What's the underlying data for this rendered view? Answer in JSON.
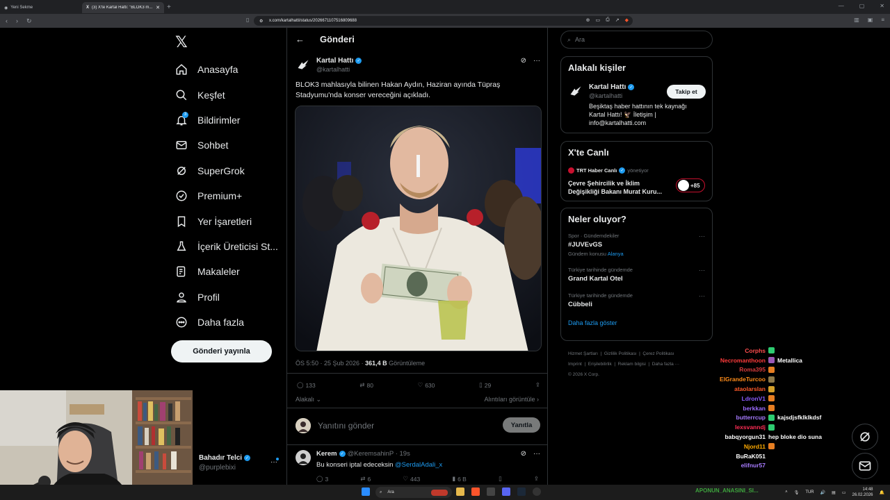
{
  "browser": {
    "tabs": [
      {
        "title": "Yeni Sekme",
        "active": false
      },
      {
        "title": "(3) X'te Kartal Hattı: \"BLOK3 m...",
        "active": true
      }
    ],
    "url": "x.com/kartalhatti/status/2026671107516809688"
  },
  "sidebar": {
    "items": [
      {
        "label": "Anasayfa",
        "icon": "home-icon"
      },
      {
        "label": "Keşfet",
        "icon": "search-icon"
      },
      {
        "label": "Bildirimler",
        "icon": "bell-icon",
        "badge": "3"
      },
      {
        "label": "Sohbet",
        "icon": "mail-icon"
      },
      {
        "label": "SuperGrok",
        "icon": "grok-icon"
      },
      {
        "label": "Premium+",
        "icon": "verified-icon"
      },
      {
        "label": "Yer İşaretleri",
        "icon": "bookmark-icon"
      },
      {
        "label": "İçerik Üreticisi St...",
        "icon": "flask-icon"
      },
      {
        "label": "Makaleler",
        "icon": "article-icon"
      },
      {
        "label": "Profil",
        "icon": "person-icon"
      },
      {
        "label": "Daha fazla",
        "icon": "more-icon"
      }
    ],
    "post_button": "Gönderi yayınla",
    "account": {
      "name": "Bahadır Telci",
      "handle": "@purplebixi"
    }
  },
  "main": {
    "header": "Gönderi",
    "author": {
      "name": "Kartal Hattı",
      "handle": "@kartalhatti"
    },
    "text": "BLOK3 mahlasıyla bilinen Hakan Aydın, Haziran ayında Tüpraş Stadyumu'nda konser vereceğini açıkladı.",
    "time": "ÖS 5:50 · 25 Şub 2026 · ",
    "views_count": "361,4 B",
    "views_label": " Görüntüleme",
    "stats": {
      "replies": "133",
      "reposts": "80",
      "likes": "630",
      "bookmarks": "29"
    },
    "sort_label": "Alakalı",
    "quotes_label": "Alıntıları görüntüle",
    "reply_placeholder": "Yanıtını gönder",
    "reply_button": "Yanıtla",
    "reply": {
      "name": "Kerem",
      "handle": "@KeremsahinP · 19s",
      "text": "Bu konseri iptal edeceksin ",
      "mention": "@SerdalAdali_x",
      "stats": {
        "replies": "3",
        "reposts": "6",
        "likes": "443",
        "views": "6 B"
      }
    }
  },
  "right": {
    "search_placeholder": "Ara",
    "related_title": "Alakalı kişiler",
    "related": {
      "name": "Kartal Hattı",
      "handle": "@kartalhatti",
      "follow": "Takip et",
      "bio": "Beşiktaş haber hattının tek kaynağı Kartal Hattı! 🦅 İletişim | info@kartalhatti.com"
    },
    "live_title": "X'te Canlı",
    "live": {
      "host": "TRT Haber Canlı",
      "role": "yönetiyor",
      "title": "Çevre Şehircilik ve İklim Değişikliği Bakanı Murat Kuru...",
      "plus": "+85"
    },
    "trends_title": "Neler oluyor?",
    "trends": [
      {
        "category": "Spor · Gündemdekiler",
        "title": "#JUVEvGS",
        "sub": "Gündem konusu ",
        "sub_link": "Alanya"
      },
      {
        "category": "Türkiye tarihinde gündemde",
        "title": "Grand Kartal Otel",
        "sub": "",
        "sub_link": ""
      },
      {
        "category": "Türkiye tarihinde gündemde",
        "title": "Cübbeli",
        "sub": "",
        "sub_link": ""
      }
    ],
    "show_more": "Daha fazla göster",
    "footer": [
      "Hizmet Şartları",
      "Gizlilik Politikası",
      "Çerez Politikası",
      "Imprint",
      "Erişilebilirlik",
      "Reklam bilgisi",
      "Daha fazla ···",
      "© 2026 X Corp."
    ]
  },
  "chat": [
    {
      "user": "Corphs",
      "color": "#ff4d4d",
      "badge": "#2ecc71",
      "msg": ""
    },
    {
      "user": "Necromanthoon",
      "color": "#ff3b3b",
      "badge": "#9b59b6",
      "msg": "Metallica"
    },
    {
      "user": "Roma395",
      "color": "#d83c3c",
      "badge": "#e67e22",
      "msg": ""
    },
    {
      "user": "ElGrandeTurcoo",
      "color": "#ff8c1a",
      "badge": "#8e7a4a",
      "msg": ""
    },
    {
      "user": "ataolarslan",
      "color": "#ff5a2a",
      "badge": "#d4a02a",
      "msg": ""
    },
    {
      "user": "LdronV1",
      "color": "#8a5cff",
      "badge": "#e67e22",
      "msg": ""
    },
    {
      "user": "berkkan",
      "color": "#9c6bff",
      "badge": "#e67e22",
      "msg": ""
    },
    {
      "user": "butterrcup",
      "color": "#a77bff",
      "badge": "#2ecc71",
      "msg": "kajsdjsfklklkdsf"
    },
    {
      "user": "lexsvanndj",
      "color": "#ff2d55",
      "badge": "#2ecc71",
      "msg": ""
    },
    {
      "user": "babqyorgun31",
      "color": "#ffffff",
      "badge": "",
      "msg": "hep bloke dio suna"
    },
    {
      "user": "Njord11",
      "color": "#ffaa00",
      "badge": "#e67e22",
      "msg": ""
    },
    {
      "user": "BuRaK051",
      "color": "#ffffff",
      "badge": "",
      "msg": ""
    },
    {
      "user": "elifnur57",
      "color": "#a77bff",
      "badge": "",
      "msg": ""
    }
  ],
  "taskbar": {
    "search": "Ara",
    "marquee": "APONUN_ANASINI_SI...",
    "lang": "TUR",
    "time": "14:48",
    "date": "26.02.2026"
  },
  "colors": {
    "accent": "#1d9bf0",
    "background": "#000000",
    "border": "#2f3336",
    "muted": "#71767b"
  }
}
